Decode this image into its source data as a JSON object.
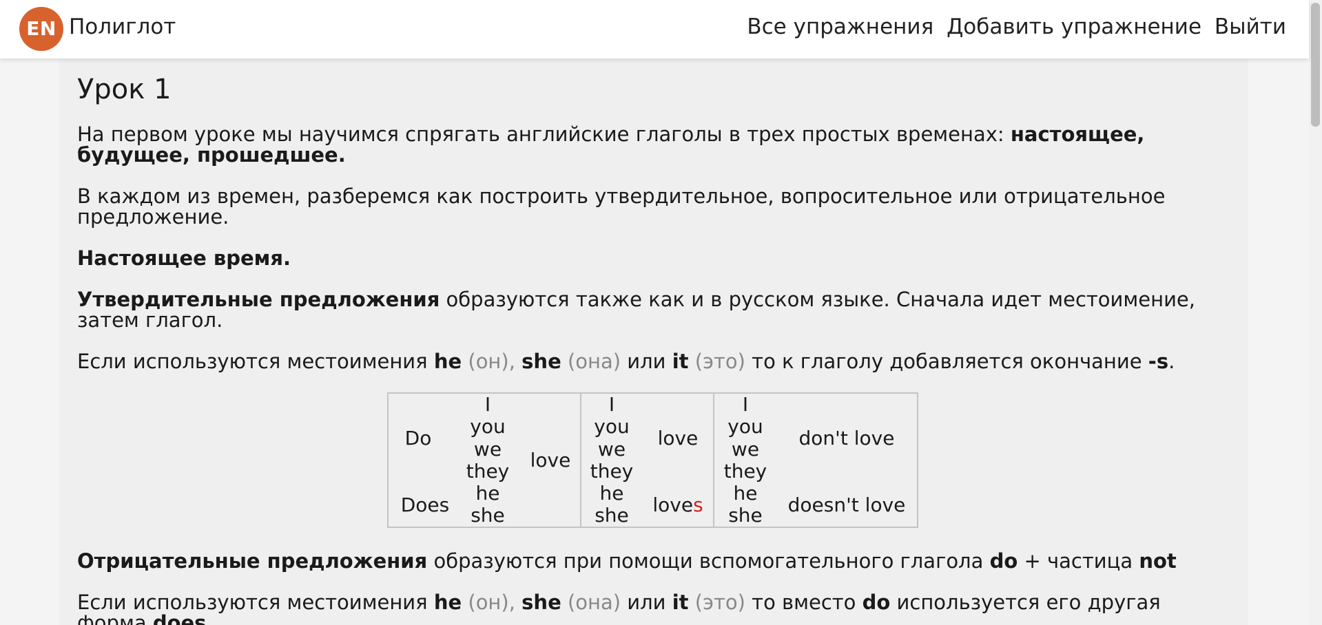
{
  "header": {
    "logo_text": "EN",
    "brand": "Полиглот",
    "nav": [
      "Все упражнения",
      "Добавить упражнение",
      "Выйти"
    ]
  },
  "lesson": {
    "title": "Урок 1",
    "intro": "На первом уроке мы научимся спрягать английские глаголы в трех простых временах:",
    "intro_bold": "настоящее, будущее, прошедшее.",
    "para2": "В каждом из времен, разберемся как построить утвердительное, вопросительное или отрицательное предложение.",
    "present_heading": "Настоящее время.",
    "affirm_bold": "Утвердительные предложения",
    "affirm_text": "образуются также как и в русском языке. Сначала идет местоимение, затем глагол.",
    "rule1": {
      "pre": "Если используются местоимения",
      "he": "he",
      "he_tr": "(он),",
      "she": "she",
      "she_tr": "(она)",
      "or": "или",
      "it": "it",
      "it_tr": "(это)",
      "post": "то к глаголу добавляется окончание",
      "ending": "-s",
      "dot": "."
    },
    "table": {
      "q_do": "Do",
      "q_does": "Does",
      "pronouns_a": [
        "I",
        "you",
        "we",
        "they",
        "he",
        "she"
      ],
      "q_verb": "love",
      "pronouns_b": [
        "I",
        "you",
        "we",
        "they",
        "he",
        "she"
      ],
      "aff_love": "love",
      "aff_loves_stem": "love",
      "aff_loves_suffix": "s",
      "pronouns_c": [
        "I",
        "you",
        "we",
        "they",
        "he",
        "she"
      ],
      "neg_dont": "don't love",
      "neg_doesnt": "doesn't love"
    },
    "neg_bold": "Отрицательные предложения",
    "neg_text": "образуются при помощи вспомогательного глагола",
    "neg_do": "do",
    "neg_plus": "+ частица",
    "neg_not": "not",
    "rule2": {
      "pre": "Если используются местоимения",
      "he": "he",
      "he_tr": "(он),",
      "she": "she",
      "she_tr": "(она)",
      "or": "или",
      "it": "it",
      "it_tr": "(это)",
      "post": "то вместо",
      "do": "do",
      "post2": "используется его другая форма",
      "does": "does"
    }
  }
}
